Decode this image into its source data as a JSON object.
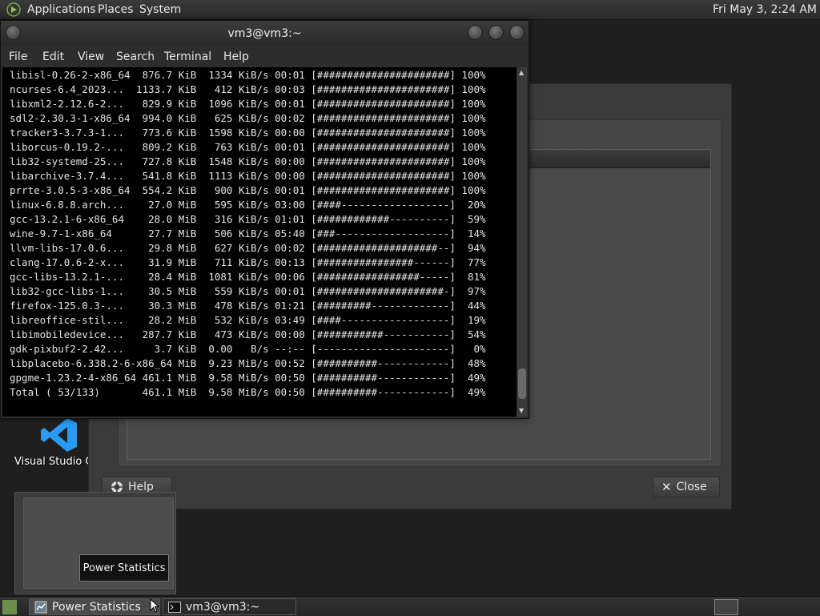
{
  "top_panel": {
    "applications": "Applications",
    "places": "Places",
    "system": "System",
    "clock": "Fri May  3,  2:24 AM"
  },
  "power_window": {
    "help_label": "Help",
    "close_label": "Close"
  },
  "desktop": {
    "vscode_label": "Visual Studio Code"
  },
  "terminal": {
    "title": "vm3@vm3:~",
    "menu": [
      "File",
      "Edit",
      "View",
      "Search",
      "Terminal",
      "Help"
    ],
    "lines": [
      "libisl-0.26-2-x86_64  876.7 KiB  1334 KiB/s 00:01 [######################] 100%",
      "ncurses-6.4_2023...  1133.7 KiB   412 KiB/s 00:03 [######################] 100%",
      "libxml2-2.12.6-2...   829.9 KiB  1096 KiB/s 00:01 [######################] 100%",
      "sdl2-2.30.3-1-x86_64  994.0 KiB   625 KiB/s 00:02 [######################] 100%",
      "tracker3-3.7.3-1...   773.6 KiB  1598 KiB/s 00:00 [######################] 100%",
      "liborcus-0.19.2-...   809.2 KiB   763 KiB/s 00:01 [######################] 100%",
      "lib32-systemd-25...   727.8 KiB  1548 KiB/s 00:00 [######################] 100%",
      "libarchive-3.7.4...   541.8 KiB  1113 KiB/s 00:00 [######################] 100%",
      "prrte-3.0.5-3-x86_64  554.2 KiB   900 KiB/s 00:01 [######################] 100%",
      "linux-6.8.8.arch...    27.0 MiB   595 KiB/s 03:00 [####------------------]  20%",
      "gcc-13.2.1-6-x86_64    28.0 MiB   316 KiB/s 01:01 [############----------]  59%",
      "wine-9.7-1-x86_64      27.7 MiB   506 KiB/s 05:40 [###-------------------]  14%",
      "llvm-libs-17.0.6...    29.8 MiB   627 KiB/s 00:02 [####################--]  94%",
      "clang-17.0.6-2-x...    31.9 MiB   711 KiB/s 00:13 [################------]  77%",
      "gcc-libs-13.2.1-...    28.4 MiB  1081 KiB/s 00:06 [#################-----]  81%",
      "lib32-gcc-libs-1...    30.5 MiB   559 KiB/s 00:01 [#####################-]  97%",
      "firefox-125.0.3-...    30.3 MiB   478 KiB/s 01:21 [#########-------------]  44%",
      "libreoffice-stil...    28.2 MiB   532 KiB/s 03:49 [####------------------]  19%",
      "libimobiledevice...   287.7 KiB   473 KiB/s 00:00 [###########-----------]  54%",
      "gdk-pixbuf2-2.42...     3.7 KiB  0.00   B/s --:-- [----------------------]   0%",
      "libplacebo-6.338.2-6-x86_64 MiB  9.23 MiB/s 00:52 [##########------------]  48%",
      "gpgme-1.23.2-4-x86_64 461.1 MiB  9.58 MiB/s 00:50 [##########------------]  49%",
      "Total ( 53/133)       461.1 MiB  9.58 MiB/s 00:50 [##########------------]  49%"
    ]
  },
  "tooltip": "Power Statistics",
  "taskbar": {
    "items": [
      {
        "label": "Power Statistics",
        "icon": "power-statistics-icon"
      },
      {
        "label": "vm3@vm3:~",
        "icon": "terminal-icon"
      }
    ]
  },
  "colors": {
    "terminal_bg": "#000000",
    "panel_bg": "#2b2b2b",
    "vscode_blue": "#2a9bf0"
  }
}
